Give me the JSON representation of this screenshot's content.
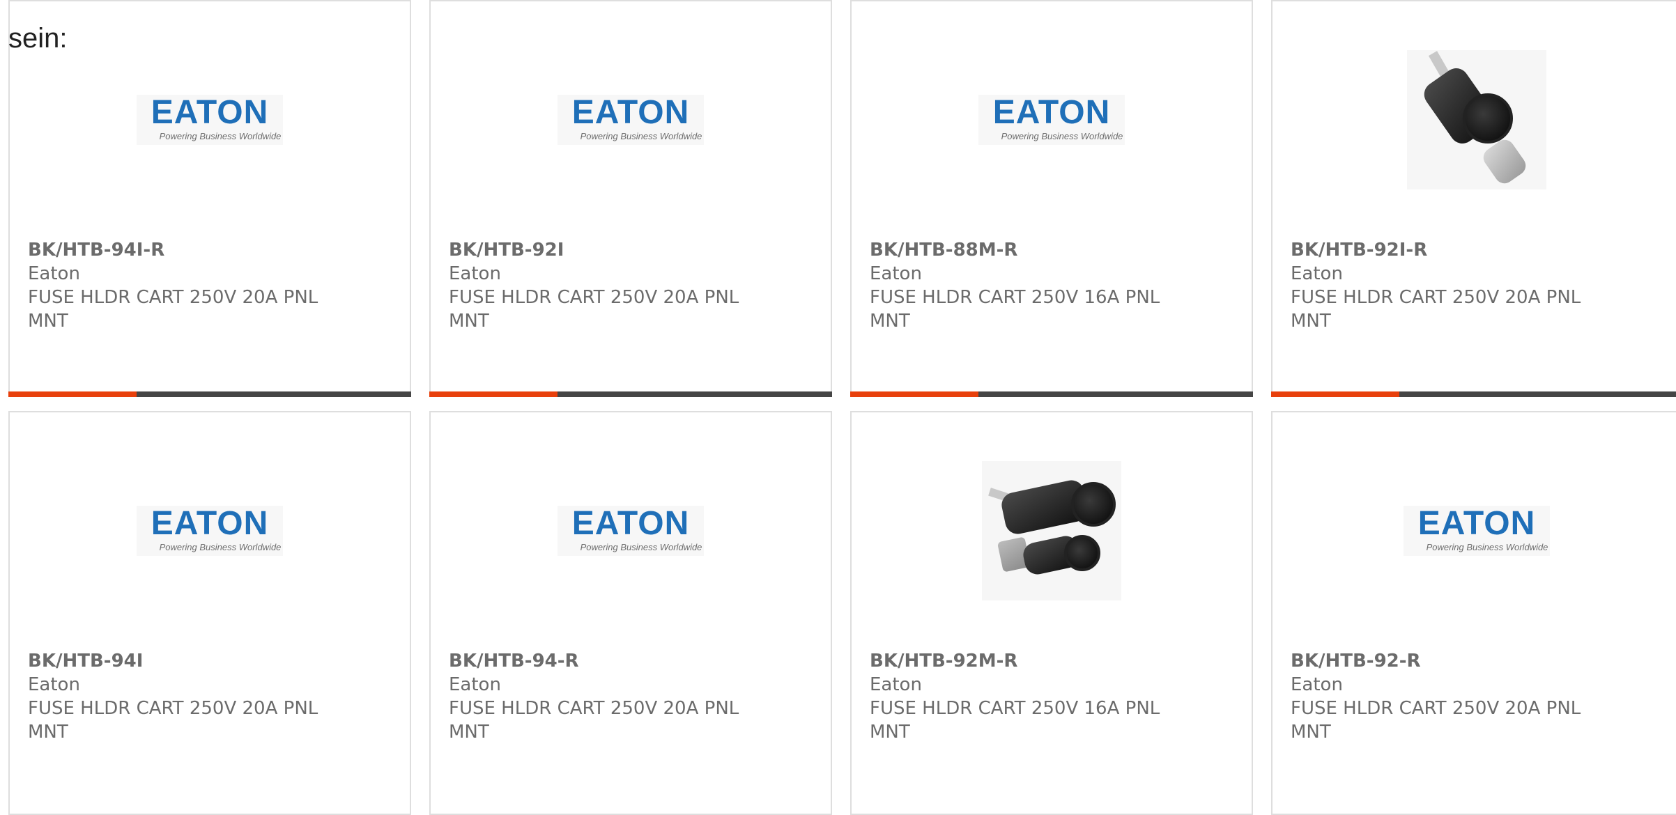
{
  "intro_text": "sein:",
  "brand": {
    "logo_word": "EATON",
    "logo_tagline": "Powering Business Worldwide",
    "logo_color": "#1f6fb8",
    "accent_color": "#e8400c",
    "bar_color": "#454545"
  },
  "products": [
    {
      "part": "BK/HTB-94I-R",
      "maker": "Eaton",
      "desc": "FUSE HLDR CART 250V 20A PNL MNT",
      "image": "eaton-logo"
    },
    {
      "part": "BK/HTB-92I",
      "maker": "Eaton",
      "desc": "FUSE HLDR CART 250V 20A PNL MNT",
      "image": "eaton-logo"
    },
    {
      "part": "BK/HTB-88M-R",
      "maker": "Eaton",
      "desc": "FUSE HLDR CART 250V 16A PNL MNT",
      "image": "eaton-logo"
    },
    {
      "part": "BK/HTB-92I-R",
      "maker": "Eaton",
      "desc": "FUSE HLDR CART 250V 20A PNL MNT",
      "image": "fuse-holder-photo"
    },
    {
      "part": "BK/HTB-94I",
      "maker": "Eaton",
      "desc": "FUSE HLDR CART 250V 20A PNL MNT",
      "image": "eaton-logo"
    },
    {
      "part": "BK/HTB-94-R",
      "maker": "Eaton",
      "desc": "FUSE HLDR CART 250V 20A PNL MNT",
      "image": "eaton-logo"
    },
    {
      "part": "BK/HTB-92M-R",
      "maker": "Eaton",
      "desc": "FUSE HLDR CART 250V 16A PNL MNT",
      "image": "fuse-holder-photo"
    },
    {
      "part": "BK/HTB-92-R",
      "maker": "Eaton",
      "desc": "FUSE HLDR CART 250V 20A PNL MNT",
      "image": "eaton-logo"
    }
  ]
}
